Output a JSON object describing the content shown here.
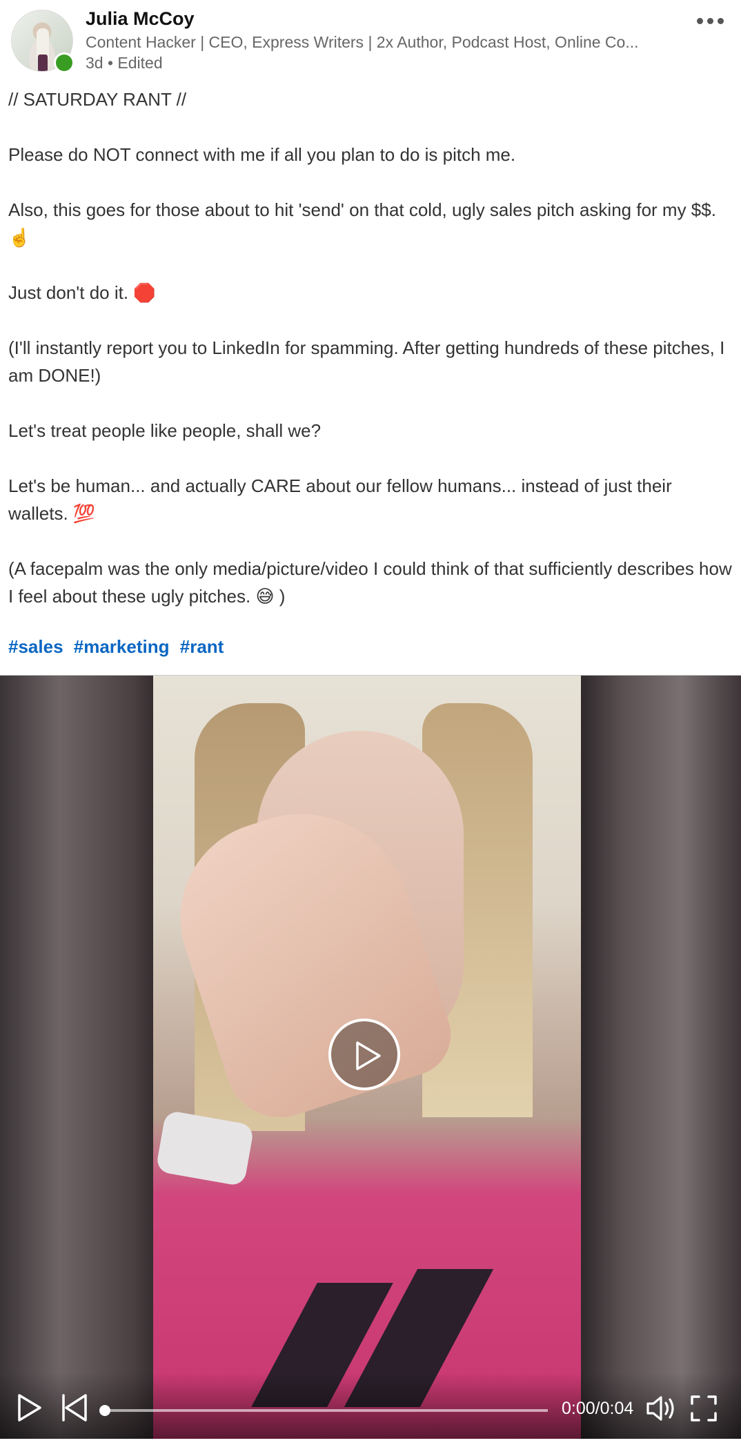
{
  "author": {
    "name": "Julia McCoy",
    "headline": "Content Hacker | CEO, Express Writers | 2x Author, Podcast Host, Online Co...",
    "meta": "3d • Edited"
  },
  "post": {
    "paragraphs": [
      "// SATURDAY RANT //",
      "Please do NOT connect with me if all you plan to do is pitch me.",
      "Also, this goes for those about to hit 'send' on that cold, ugly sales pitch asking for my $$. ☝️",
      "Just don't do it. 🛑",
      "(I'll instantly report you to LinkedIn for spamming. After getting hundreds of these pitches, I am DONE!)",
      "Let's treat people like people, shall we?",
      "Let's be human... and actually CARE about our fellow humans... instead of just their wallets. 💯",
      "(A facepalm was the only media/picture/video I could think of that sufficiently describes how I feel about these ugly pitches. 😅 )"
    ],
    "hashtags": [
      "#sales",
      "#marketing",
      "#rant"
    ]
  },
  "video": {
    "time": "0:00/0:04",
    "progress_fraction": 0
  },
  "colors": {
    "link": "#0a66c2",
    "online": "#3a9d23"
  }
}
